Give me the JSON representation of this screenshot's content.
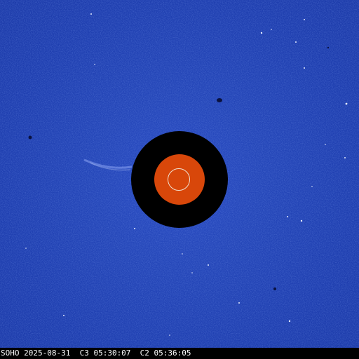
{
  "caption": "SOHO 2025-08-31  C3 05:30:07  C2 05:36:05",
  "colors": {
    "sky": "#2145b7",
    "occulter": "#000000",
    "c2_field": "#d8470a",
    "sun_outline": "#f0e0d0",
    "caption_text": "#ffffff"
  }
}
